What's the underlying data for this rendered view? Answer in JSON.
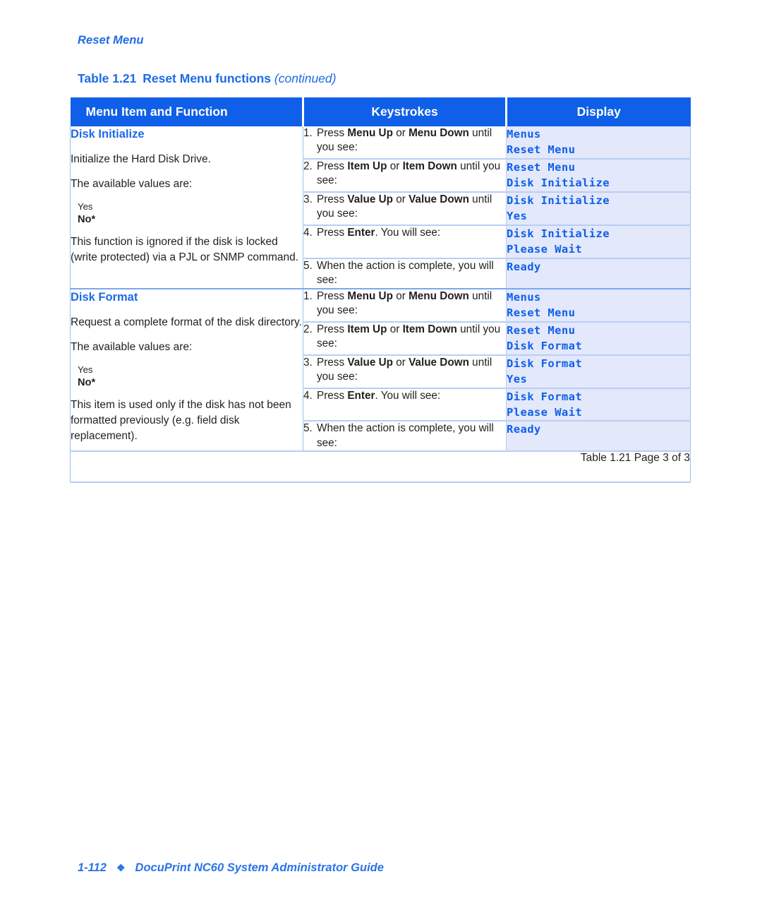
{
  "running_head": "Reset Menu",
  "table_caption": {
    "number": "Table 1.21",
    "title": "Reset Menu functions",
    "continued": "(continued)"
  },
  "colors": {
    "header_blue": "#0F5FE8",
    "display_bg": "#E3E8FB",
    "display_text": "#0F5FE8",
    "rule_blue": "#B9CEF5",
    "accent_text": "#1C6AE8"
  },
  "table": {
    "columns": [
      {
        "label": "Menu Item and Function"
      },
      {
        "label": "Keystrokes"
      },
      {
        "label": "Display"
      }
    ],
    "sections": [
      {
        "menu_item": {
          "title": "Disk Initialize",
          "paragraphs": [
            "Initialize the Hard Disk Drive.",
            "The available values are:"
          ],
          "values": [
            {
              "text": "Yes",
              "default": false
            },
            {
              "text": "No*",
              "default": true
            }
          ],
          "note": "This function is ignored if the disk is locked (write protected) via a PJL or SNMP command."
        },
        "steps": [
          {
            "n": "1.",
            "parts": [
              {
                "t": "Press ",
                "b": false
              },
              {
                "t": "Menu Up",
                "b": true
              },
              {
                "t": " or ",
                "b": false
              },
              {
                "t": "Menu Down",
                "b": true
              },
              {
                "t": " until you see:",
                "b": false
              }
            ],
            "display": [
              "Menus",
              "Reset Menu"
            ]
          },
          {
            "n": "2.",
            "parts": [
              {
                "t": "Press ",
                "b": false
              },
              {
                "t": "Item Up",
                "b": true
              },
              {
                "t": " or ",
                "b": false
              },
              {
                "t": "Item Down",
                "b": true
              },
              {
                "t": " until you see:",
                "b": false
              }
            ],
            "display": [
              "Reset Menu",
              "Disk Initialize"
            ]
          },
          {
            "n": "3.",
            "parts": [
              {
                "t": "Press ",
                "b": false
              },
              {
                "t": "Value Up",
                "b": true
              },
              {
                "t": " or ",
                "b": false
              },
              {
                "t": "Value Down",
                "b": true
              },
              {
                "t": " until you see:",
                "b": false
              }
            ],
            "display": [
              "Disk Initialize",
              "Yes"
            ]
          },
          {
            "n": "4.",
            "parts": [
              {
                "t": "Press ",
                "b": false
              },
              {
                "t": "Enter",
                "b": true
              },
              {
                "t": ". You will see:",
                "b": false
              }
            ],
            "display": [
              "Disk Initialize",
              "Please Wait"
            ]
          },
          {
            "n": "5.",
            "parts": [
              {
                "t": "When the action is complete, you will see:",
                "b": false
              }
            ],
            "display": [
              "Ready"
            ]
          }
        ]
      },
      {
        "menu_item": {
          "title": "Disk Format",
          "paragraphs": [
            "Request a complete format of the disk directory.",
            "The available values are:"
          ],
          "values": [
            {
              "text": "Yes",
              "default": false
            },
            {
              "text": "No*",
              "default": true
            }
          ],
          "note": "This item is used only if the disk has not been formatted previously (e.g. field disk replacement)."
        },
        "steps": [
          {
            "n": "1.",
            "parts": [
              {
                "t": "Press ",
                "b": false
              },
              {
                "t": "Menu Up",
                "b": true
              },
              {
                "t": " or ",
                "b": false
              },
              {
                "t": "Menu Down",
                "b": true
              },
              {
                "t": " until you see:",
                "b": false
              }
            ],
            "display": [
              "Menus",
              "Reset Menu"
            ]
          },
          {
            "n": "2.",
            "parts": [
              {
                "t": "Press ",
                "b": false
              },
              {
                "t": "Item Up",
                "b": true
              },
              {
                "t": " or ",
                "b": false
              },
              {
                "t": "Item Down",
                "b": true
              },
              {
                "t": " until you see:",
                "b": false
              }
            ],
            "display": [
              "Reset Menu",
              "Disk Format"
            ]
          },
          {
            "n": "3.",
            "parts": [
              {
                "t": "Press ",
                "b": false
              },
              {
                "t": "Value Up",
                "b": true
              },
              {
                "t": " or ",
                "b": false
              },
              {
                "t": "Value Down",
                "b": true
              },
              {
                "t": " until you see:",
                "b": false
              }
            ],
            "display": [
              "Disk Format",
              "Yes"
            ]
          },
          {
            "n": "4.",
            "parts": [
              {
                "t": "Press ",
                "b": false
              },
              {
                "t": "Enter",
                "b": true
              },
              {
                "t": ". You will see:",
                "b": false
              }
            ],
            "display": [
              "Disk Format",
              "Please Wait"
            ]
          },
          {
            "n": "5.",
            "parts": [
              {
                "t": "When the action is complete, you will see:",
                "b": false
              }
            ],
            "display": [
              "Ready"
            ]
          }
        ]
      }
    ],
    "footer_note": "Table 1.21  Page 3 of 3"
  },
  "page_footer": {
    "page_number": "1-112",
    "diamond": "❖",
    "title": "DocuPrint NC60 System Administrator Guide"
  }
}
